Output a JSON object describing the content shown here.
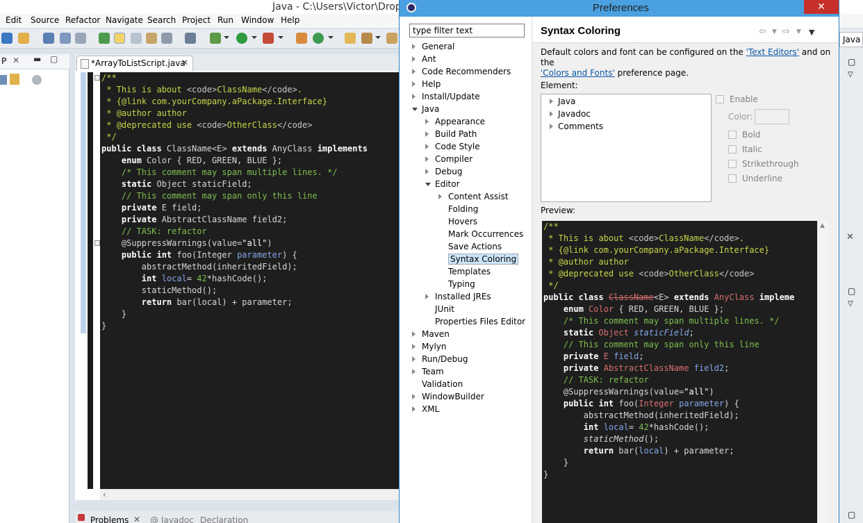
{
  "eclipse": {
    "title": "Java - C:\\Users\\Victor\\Dropb",
    "menu": [
      "Edit",
      "Source",
      "Refactor",
      "Navigate",
      "Search",
      "Project",
      "Run",
      "Window",
      "Help"
    ],
    "left_view_label": "P",
    "editor_tab": "*ArrayToListScript.java",
    "perspective": "Java",
    "bottom_tabs": [
      "Problems",
      "@ Javadoc",
      "Declaration"
    ],
    "code_lines": [
      [
        [
          "c-jd",
          "/**"
        ]
      ],
      [
        [
          "c-jd",
          " * This is about "
        ],
        [
          "c-tag",
          "<code>"
        ],
        [
          "c-jd",
          "ClassName"
        ],
        [
          "c-tag",
          "</code>"
        ],
        [
          "c-jd",
          "."
        ]
      ],
      [
        [
          "c-jd",
          " * {@link com.yourCompany.aPackage.Interface}"
        ]
      ],
      [
        [
          "c-jd",
          " * "
        ],
        [
          "c-jd",
          "@author"
        ],
        [
          "c-jd",
          " author"
        ]
      ],
      [
        [
          "c-jd",
          " * "
        ],
        [
          "c-jd",
          "@deprecated"
        ],
        [
          "c-jd",
          " use "
        ],
        [
          "c-tag",
          "<code>"
        ],
        [
          "c-jd",
          "OtherClass"
        ],
        [
          "c-tag",
          "</code>"
        ]
      ],
      [
        [
          "c-jd",
          " */"
        ]
      ],
      [
        [
          "c-kw",
          "public class"
        ],
        [
          "c-plain",
          " ClassName<E> "
        ],
        [
          "c-kw",
          "extends"
        ],
        [
          "c-plain",
          " AnyClass "
        ],
        [
          "c-kw",
          "implements"
        ]
      ],
      [
        [
          "c-plain",
          "    "
        ],
        [
          "c-kw",
          "enum"
        ],
        [
          "c-plain",
          " Color { RED, GREEN, BLUE };"
        ]
      ],
      [
        [
          "c-plain",
          "    "
        ],
        [
          "c-cm",
          "/* This comment may span multiple lines. */"
        ]
      ],
      [
        [
          "c-plain",
          "    "
        ],
        [
          "c-kw",
          "static"
        ],
        [
          "c-plain",
          " Object staticField;"
        ]
      ],
      [
        [
          "c-plain",
          "    "
        ],
        [
          "c-cm",
          "// This comment may span only this line"
        ]
      ],
      [
        [
          "c-plain",
          "    "
        ],
        [
          "c-kw",
          "private"
        ],
        [
          "c-plain",
          " E field;"
        ]
      ],
      [
        [
          "c-plain",
          "    "
        ],
        [
          "c-kw",
          "private"
        ],
        [
          "c-plain",
          " AbstractClassName field2;"
        ]
      ],
      [
        [
          "c-plain",
          "    "
        ],
        [
          "c-cm",
          "// TASK: refactor"
        ]
      ],
      [
        [
          "c-plain",
          "    @SuppressWarnings(value="
        ],
        [
          "c-str",
          "\"all\""
        ],
        [
          "c-plain",
          ")"
        ]
      ],
      [
        [
          "c-plain",
          "    "
        ],
        [
          "c-kw",
          "public int"
        ],
        [
          "c-plain",
          " foo(Integer "
        ],
        [
          "c-param",
          "parameter"
        ],
        [
          "c-plain",
          ") {"
        ]
      ],
      [
        [
          "c-plain",
          "        abstractMethod(inheritedField);"
        ]
      ],
      [
        [
          "c-plain",
          "        "
        ],
        [
          "c-kw",
          "int"
        ],
        [
          "c-plain",
          " "
        ],
        [
          "c-param",
          "local"
        ],
        [
          "c-plain",
          "= "
        ],
        [
          "c-num",
          "42"
        ],
        [
          "c-plain",
          "*hashCode();"
        ]
      ],
      [
        [
          "c-plain",
          "        staticMethod();"
        ]
      ],
      [
        [
          "c-plain",
          "        "
        ],
        [
          "c-kw",
          "return"
        ],
        [
          "c-plain",
          " bar(local) + parameter;"
        ]
      ],
      [
        [
          "c-plain",
          "    }"
        ]
      ],
      [
        [
          "c-plain",
          "}"
        ]
      ]
    ]
  },
  "prefs": {
    "title": "Preferences",
    "close_glyph": "✕",
    "filter_placeholder": "type filter text",
    "tree": [
      {
        "label": "General",
        "level": 0,
        "state": "closed"
      },
      {
        "label": "Ant",
        "level": 0,
        "state": "closed"
      },
      {
        "label": "Code Recommenders",
        "level": 0,
        "state": "closed"
      },
      {
        "label": "Help",
        "level": 0,
        "state": "closed"
      },
      {
        "label": "Install/Update",
        "level": 0,
        "state": "closed"
      },
      {
        "label": "Java",
        "level": 0,
        "state": "open"
      },
      {
        "label": "Appearance",
        "level": 1,
        "state": "closed"
      },
      {
        "label": "Build Path",
        "level": 1,
        "state": "closed"
      },
      {
        "label": "Code Style",
        "level": 1,
        "state": "closed"
      },
      {
        "label": "Compiler",
        "level": 1,
        "state": "closed"
      },
      {
        "label": "Debug",
        "level": 1,
        "state": "closed"
      },
      {
        "label": "Editor",
        "level": 1,
        "state": "open"
      },
      {
        "label": "Content Assist",
        "level": 2,
        "state": "closed"
      },
      {
        "label": "Folding",
        "level": 2,
        "state": "none"
      },
      {
        "label": "Hovers",
        "level": 2,
        "state": "none"
      },
      {
        "label": "Mark Occurrences",
        "level": 2,
        "state": "none"
      },
      {
        "label": "Save Actions",
        "level": 2,
        "state": "none"
      },
      {
        "label": "Syntax Coloring",
        "level": 2,
        "state": "none",
        "selected": true
      },
      {
        "label": "Templates",
        "level": 2,
        "state": "none"
      },
      {
        "label": "Typing",
        "level": 2,
        "state": "none"
      },
      {
        "label": "Installed JREs",
        "level": 1,
        "state": "closed"
      },
      {
        "label": "JUnit",
        "level": 1,
        "state": "none"
      },
      {
        "label": "Properties Files Editor",
        "level": 1,
        "state": "none"
      },
      {
        "label": "Maven",
        "level": 0,
        "state": "closed"
      },
      {
        "label": "Mylyn",
        "level": 0,
        "state": "closed"
      },
      {
        "label": "Run/Debug",
        "level": 0,
        "state": "closed"
      },
      {
        "label": "Team",
        "level": 0,
        "state": "closed"
      },
      {
        "label": "Validation",
        "level": 0,
        "state": "none"
      },
      {
        "label": "WindowBuilder",
        "level": 0,
        "state": "closed"
      },
      {
        "label": "XML",
        "level": 0,
        "state": "closed"
      }
    ],
    "page_title": "Syntax Coloring",
    "desc_part1": "Default colors and font can be configured on the ",
    "desc_link1": "'Text Editors'",
    "desc_part2": " and on the ",
    "desc_link2": "'Colors and Fonts'",
    "desc_part3": " preference page.",
    "element_label": "Element:",
    "element_tree": [
      "Java",
      "Javadoc",
      "Comments"
    ],
    "options": {
      "enable": "Enable",
      "color": "Color:",
      "bold": "Bold",
      "italic": "Italic",
      "strikethrough": "Strikethrough",
      "underline": "Underline"
    },
    "preview_label": "Preview:",
    "preview_lines": [
      [
        [
          "c-jd",
          "/**"
        ]
      ],
      [
        [
          "c-jd",
          " * This is about "
        ],
        [
          "c-tag",
          "<code>"
        ],
        [
          "c-jd",
          "ClassName"
        ],
        [
          "c-tag",
          "</code>"
        ],
        [
          "c-jd",
          "."
        ]
      ],
      [
        [
          "c-jd",
          " * {@link com.yourCompany.aPackage.Interface}"
        ]
      ],
      [
        [
          "c-jd",
          " * "
        ],
        [
          "c-jd",
          "@author"
        ],
        [
          "c-jd",
          " author"
        ]
      ],
      [
        [
          "c-jd",
          " * "
        ],
        [
          "c-jd",
          "@deprecated"
        ],
        [
          "c-jd",
          " use "
        ],
        [
          "c-tag",
          "<code>"
        ],
        [
          "c-jd",
          "OtherClass"
        ],
        [
          "c-tag",
          "</code>"
        ]
      ],
      [
        [
          "c-jd",
          " */"
        ]
      ],
      [
        [
          "c-kw",
          "public class"
        ],
        [
          "c-plain",
          " "
        ],
        [
          "c-strike",
          "ClassName"
        ],
        [
          "c-plain",
          "<E> "
        ],
        [
          "c-kw",
          "extends"
        ],
        [
          "c-plain",
          " "
        ],
        [
          "c-cls",
          "AnyClass"
        ],
        [
          "c-plain",
          " "
        ],
        [
          "c-kw",
          "impleme"
        ]
      ],
      [
        [
          "c-plain",
          "    "
        ],
        [
          "c-kw",
          "enum"
        ],
        [
          "c-plain",
          " "
        ],
        [
          "c-cls",
          "Color"
        ],
        [
          "c-plain",
          " { RED, GREEN, BLUE };"
        ]
      ],
      [
        [
          "c-plain",
          "    "
        ],
        [
          "c-cmt",
          "/* This comment may span multiple lines. */"
        ]
      ],
      [
        [
          "c-plain",
          "    "
        ],
        [
          "c-kw",
          "static"
        ],
        [
          "c-plain",
          " "
        ],
        [
          "c-cls",
          "Object"
        ],
        [
          "c-plain",
          " "
        ],
        [
          "c-fldi",
          "staticField"
        ],
        [
          "c-plain",
          ";"
        ]
      ],
      [
        [
          "c-plain",
          "    "
        ],
        [
          "c-cmt",
          "// This comment may span only this line"
        ]
      ],
      [
        [
          "c-plain",
          "    "
        ],
        [
          "c-kw",
          "private"
        ],
        [
          "c-plain",
          " "
        ],
        [
          "c-cls",
          "E"
        ],
        [
          "c-plain",
          " "
        ],
        [
          "c-fld",
          "field"
        ],
        [
          "c-plain",
          ";"
        ]
      ],
      [
        [
          "c-plain",
          "    "
        ],
        [
          "c-kw",
          "private"
        ],
        [
          "c-plain",
          " "
        ],
        [
          "c-cls",
          "AbstractClassName"
        ],
        [
          "c-plain",
          " "
        ],
        [
          "c-fld",
          "field2"
        ],
        [
          "c-plain",
          ";"
        ]
      ],
      [
        [
          "c-plain",
          "    "
        ],
        [
          "c-task",
          "// TASK: refactor"
        ]
      ],
      [
        [
          "c-plain",
          "    @SuppressWarnings(value="
        ],
        [
          "c-str",
          "\"all\""
        ],
        [
          "c-plain",
          ")"
        ]
      ],
      [
        [
          "c-plain",
          "    "
        ],
        [
          "c-kw",
          "public int"
        ],
        [
          "c-plain",
          " foo("
        ],
        [
          "c-cls",
          "Integer"
        ],
        [
          "c-plain",
          " "
        ],
        [
          "c-param",
          "parameter"
        ],
        [
          "c-plain",
          ") {"
        ]
      ],
      [
        [
          "c-plain",
          "        abstractMethod(inheritedField);"
        ]
      ],
      [
        [
          "c-plain",
          "        "
        ],
        [
          "c-kw",
          "int"
        ],
        [
          "c-plain",
          " "
        ],
        [
          "c-param",
          "local"
        ],
        [
          "c-plain",
          "= "
        ],
        [
          "c-num",
          "42"
        ],
        [
          "c-plain",
          "*hashCode();"
        ]
      ],
      [
        [
          "c-plain",
          "        "
        ],
        [
          "c-ita",
          "staticMethod"
        ],
        [
          "c-plain",
          "();"
        ]
      ],
      [
        [
          "c-plain",
          "        "
        ],
        [
          "c-kw",
          "return"
        ],
        [
          "c-plain",
          " bar("
        ],
        [
          "c-param",
          "local"
        ],
        [
          "c-plain",
          ") + parameter;"
        ]
      ],
      [
        [
          "c-plain",
          "    }"
        ]
      ],
      [
        [
          "c-plain",
          "}"
        ]
      ]
    ]
  }
}
